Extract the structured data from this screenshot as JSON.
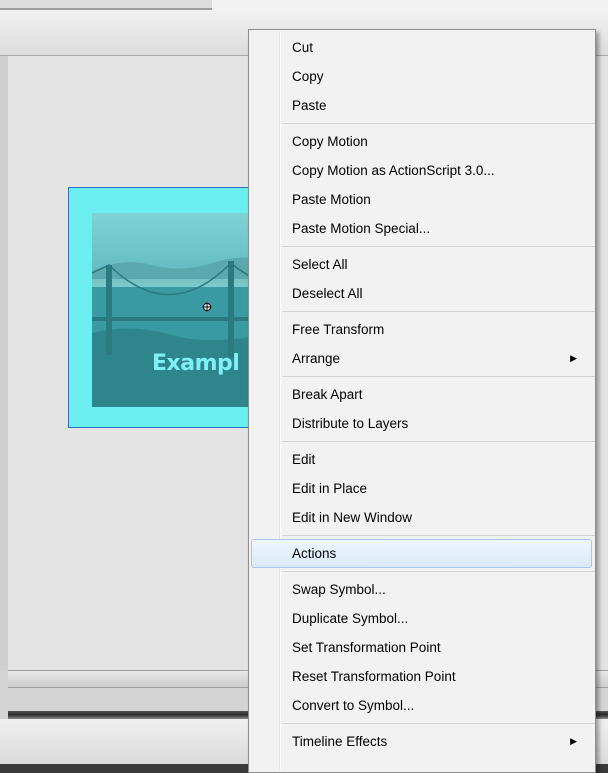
{
  "photo": {
    "label": "Exampl"
  },
  "context_menu": {
    "groups": [
      {
        "items": [
          {
            "label": "Cut"
          },
          {
            "label": "Copy"
          },
          {
            "label": "Paste"
          }
        ]
      },
      {
        "items": [
          {
            "label": "Copy Motion"
          },
          {
            "label": "Copy Motion as ActionScript 3.0..."
          },
          {
            "label": "Paste Motion"
          },
          {
            "label": "Paste Motion Special..."
          }
        ]
      },
      {
        "items": [
          {
            "label": "Select All"
          },
          {
            "label": "Deselect All"
          }
        ]
      },
      {
        "items": [
          {
            "label": "Free Transform"
          },
          {
            "label": "Arrange",
            "submenu": true
          }
        ]
      },
      {
        "items": [
          {
            "label": "Break Apart"
          },
          {
            "label": "Distribute to Layers"
          }
        ]
      },
      {
        "items": [
          {
            "label": "Edit"
          },
          {
            "label": "Edit in Place"
          },
          {
            "label": "Edit in New Window"
          }
        ]
      },
      {
        "items": [
          {
            "label": "Actions",
            "highlighted": true
          }
        ]
      },
      {
        "items": [
          {
            "label": "Swap Symbol..."
          },
          {
            "label": "Duplicate Symbol..."
          },
          {
            "label": "Set Transformation Point"
          },
          {
            "label": "Reset Transformation Point"
          },
          {
            "label": "Convert to Symbol..."
          }
        ]
      },
      {
        "items": [
          {
            "label": "Timeline Effects",
            "submenu": true
          }
        ]
      }
    ],
    "submenu_arrow": "▶"
  },
  "colors": {
    "symbol_fill": "#6aeef0",
    "symbol_border": "#2a6fb8",
    "menu_highlight": "#dbeaf9"
  }
}
